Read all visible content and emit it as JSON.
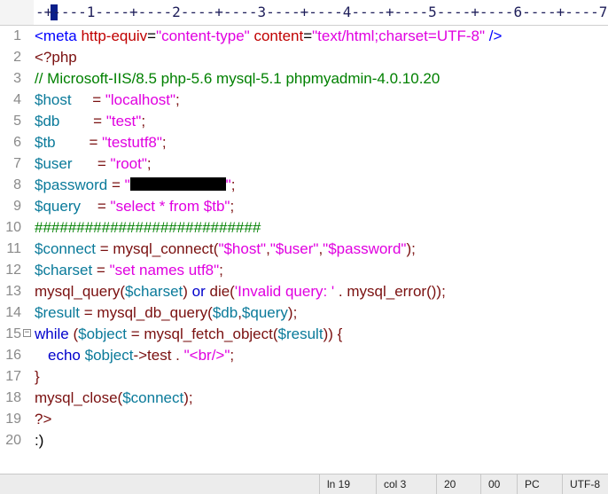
{
  "ruler": {
    "text": "-+----1----+----2----+----3----+----4----+----5----+----6----+----7"
  },
  "editor": {
    "lines": [
      {
        "num": "1",
        "segs": [
          [
            "t-tag",
            "<meta "
          ],
          [
            "t-attr",
            "http-equiv"
          ],
          [
            "t-txt",
            "="
          ],
          [
            "t-str",
            "\"content-type\""
          ],
          [
            "t-txt",
            " "
          ],
          [
            "t-attr",
            "content"
          ],
          [
            "t-txt",
            "="
          ],
          [
            "t-str",
            "\"text/html;charset=UTF-8\""
          ],
          [
            "t-tag",
            " />"
          ]
        ]
      },
      {
        "num": "2",
        "segs": [
          [
            "t-php",
            "<?php"
          ]
        ]
      },
      {
        "num": "3",
        "segs": [
          [
            "t-cmt",
            "// Microsoft-IIS/8.5 php-5.6 mysql-5.1 phpmyadmin-4.0.10.20"
          ]
        ]
      },
      {
        "num": "4",
        "segs": [
          [
            "t-var",
            "$host"
          ],
          [
            "t-txt",
            "     "
          ],
          [
            "t-op",
            "= "
          ],
          [
            "t-str",
            "\"localhost\""
          ],
          [
            "t-op",
            ";"
          ]
        ]
      },
      {
        "num": "5",
        "segs": [
          [
            "t-var",
            "$db"
          ],
          [
            "t-txt",
            "        "
          ],
          [
            "t-op",
            "= "
          ],
          [
            "t-str",
            "\"test\""
          ],
          [
            "t-op",
            ";"
          ]
        ]
      },
      {
        "num": "6",
        "segs": [
          [
            "t-var",
            "$tb"
          ],
          [
            "t-txt",
            "        "
          ],
          [
            "t-op",
            "= "
          ],
          [
            "t-str",
            "\"testutf8\""
          ],
          [
            "t-op",
            ";"
          ]
        ]
      },
      {
        "num": "7",
        "segs": [
          [
            "t-var",
            "$user"
          ],
          [
            "t-txt",
            "      "
          ],
          [
            "t-op",
            "= "
          ],
          [
            "t-str",
            "\"root\""
          ],
          [
            "t-op",
            ";"
          ]
        ]
      },
      {
        "num": "8",
        "segs": [
          [
            "t-var",
            "$password"
          ],
          [
            "t-txt",
            " "
          ],
          [
            "t-op",
            "= "
          ],
          [
            "t-str",
            "\""
          ],
          [
            "redact",
            ""
          ],
          [
            "t-str",
            "\""
          ],
          [
            "t-op",
            ";"
          ]
        ]
      },
      {
        "num": "9",
        "segs": [
          [
            "t-var",
            "$query"
          ],
          [
            "t-txt",
            "    "
          ],
          [
            "t-op",
            "= "
          ],
          [
            "t-str",
            "\"select * from $tb\""
          ],
          [
            "t-op",
            ";"
          ]
        ]
      },
      {
        "num": "10",
        "segs": [
          [
            "t-cmt",
            "###########################"
          ]
        ]
      },
      {
        "num": "11",
        "segs": [
          [
            "t-var",
            "$connect"
          ],
          [
            "t-op",
            " = "
          ],
          [
            "t-fn",
            "mysql_connect("
          ],
          [
            "t-str",
            "\"$host\""
          ],
          [
            "t-op",
            ","
          ],
          [
            "t-str",
            "\"$user\""
          ],
          [
            "t-op",
            ","
          ],
          [
            "t-str",
            "\"$password\""
          ],
          [
            "t-op",
            ");"
          ]
        ]
      },
      {
        "num": "12",
        "segs": [
          [
            "t-var",
            "$charset"
          ],
          [
            "t-op",
            " = "
          ],
          [
            "t-str",
            "\"set names utf8\""
          ],
          [
            "t-op",
            ";"
          ]
        ]
      },
      {
        "num": "13",
        "segs": [
          [
            "t-fn",
            "mysql_query("
          ],
          [
            "t-var",
            "$charset"
          ],
          [
            "t-fn",
            ") "
          ],
          [
            "t-kw",
            "or"
          ],
          [
            "t-fn",
            " die("
          ],
          [
            "t-str",
            "'Invalid query: '"
          ],
          [
            "t-op",
            " . "
          ],
          [
            "t-fn",
            "mysql_error());"
          ]
        ]
      },
      {
        "num": "14",
        "segs": [
          [
            "t-var",
            "$result"
          ],
          [
            "t-op",
            " = "
          ],
          [
            "t-fn",
            "mysql_db_query("
          ],
          [
            "t-var",
            "$db"
          ],
          [
            "t-op",
            ","
          ],
          [
            "t-var",
            "$query"
          ],
          [
            "t-fn",
            ");"
          ]
        ]
      },
      {
        "num": "15",
        "fold": "⊟",
        "segs": [
          [
            "t-kw",
            "while"
          ],
          [
            "t-fn",
            " ("
          ],
          [
            "t-var",
            "$object"
          ],
          [
            "t-op",
            " = "
          ],
          [
            "t-fn",
            "mysql_fetch_object("
          ],
          [
            "t-var",
            "$result"
          ],
          [
            "t-fn",
            ")) {"
          ]
        ]
      },
      {
        "num": "16",
        "indent": true,
        "segs": [
          [
            "t-kw",
            "echo"
          ],
          [
            "t-txt",
            " "
          ],
          [
            "t-var",
            "$object"
          ],
          [
            "t-op",
            "->"
          ],
          [
            "t-fn",
            "test"
          ],
          [
            "t-op",
            " . "
          ],
          [
            "t-str",
            "\"<br/>\""
          ],
          [
            "t-op",
            ";"
          ]
        ]
      },
      {
        "num": "17",
        "segs": [
          [
            "t-fn",
            "}"
          ]
        ]
      },
      {
        "num": "18",
        "segs": [
          [
            "t-fn",
            "mysql_close("
          ],
          [
            "t-var",
            "$connect"
          ],
          [
            "t-fn",
            ");"
          ]
        ]
      },
      {
        "num": "19",
        "segs": [
          [
            "t-php",
            "?>"
          ]
        ]
      },
      {
        "num": "20",
        "segs": [
          [
            "t-txt",
            ":)"
          ]
        ]
      }
    ]
  },
  "status": {
    "line": "ln 19",
    "col": "col 3",
    "sel": "20",
    "mode": "00",
    "eol": "PC",
    "encoding": "UTF-8"
  }
}
